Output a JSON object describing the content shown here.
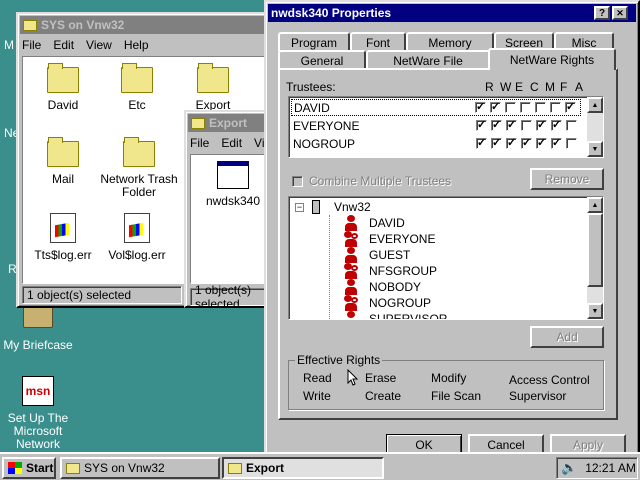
{
  "desktop": {
    "briefcase_label": "My Briefcase",
    "msn_line1": "Set Up The",
    "msn_line2": "Microsoft",
    "msn_line3": "Network",
    "msn_logo": "msn",
    "partial_labels": [
      "M",
      "Ne",
      "R"
    ]
  },
  "sys_window": {
    "title": "SYS on Vnw32",
    "menu": [
      "File",
      "Edit",
      "View",
      "Help"
    ],
    "items": [
      {
        "label": "David",
        "icon": "folder-icon"
      },
      {
        "label": "Etc",
        "icon": "folder-icon"
      },
      {
        "label": "Export",
        "icon": "folder-icon"
      },
      {
        "label": "Mail",
        "icon": "folder-icon"
      },
      {
        "label": "Network Trash Folder",
        "icon": "folder-icon"
      },
      {
        "label": "Tts$log.err",
        "icon": "file-icon"
      },
      {
        "label": "Vol$log.err",
        "icon": "file-icon"
      }
    ],
    "status": "1 object(s) selected"
  },
  "export_window": {
    "title": "Export",
    "menu": [
      "File",
      "Edit",
      "Vie"
    ],
    "item_label": "nwdsk340",
    "status": "1 object(s) selected"
  },
  "props": {
    "title": "nwdsk340 Properties",
    "help_btn": "?",
    "close_btn": "✕",
    "tabs_row1": [
      "Program",
      "Font",
      "Memory",
      "Screen",
      "Misc"
    ],
    "tabs_row2": [
      "General",
      "NetWare File",
      "NetWare Rights"
    ],
    "trustees_label": "Trustees:",
    "rights_headers": [
      "R",
      "W",
      "E",
      "C",
      "M",
      "F",
      "A"
    ],
    "trustees": [
      {
        "name": "DAVID",
        "rights": [
          true,
          true,
          false,
          false,
          false,
          false,
          true
        ]
      },
      {
        "name": "EVERYONE",
        "rights": [
          true,
          true,
          true,
          false,
          true,
          true,
          false
        ]
      },
      {
        "name": "NOGROUP",
        "rights": [
          true,
          true,
          true,
          true,
          true,
          true,
          false
        ]
      }
    ],
    "combine_label": "Combine Multiple Trustees",
    "remove_btn": "Remove",
    "tree_root": "Vnw32",
    "tree_items": [
      {
        "name": "DAVID",
        "kind": "user"
      },
      {
        "name": "EVERYONE",
        "kind": "group"
      },
      {
        "name": "GUEST",
        "kind": "user"
      },
      {
        "name": "NFSGROUP",
        "kind": "group"
      },
      {
        "name": "NOBODY",
        "kind": "user"
      },
      {
        "name": "NOGROUP",
        "kind": "group"
      },
      {
        "name": "SUPERVISOR",
        "kind": "user"
      }
    ],
    "add_btn": "Add",
    "effective_rights": {
      "label": "Effective Rights",
      "col1": [
        "Read",
        "Write"
      ],
      "col2": [
        "Erase",
        "Create"
      ],
      "col3": [
        "Modify",
        "File Scan"
      ],
      "col4": [
        "Access Control",
        "Supervisor"
      ]
    },
    "ok_btn": "OK",
    "cancel_btn": "Cancel",
    "apply_btn": "Apply"
  },
  "taskbar": {
    "start": "Start",
    "tasks": [
      {
        "label": "SYS on Vnw32",
        "pressed": false
      },
      {
        "label": "Export",
        "pressed": true
      }
    ],
    "clock": "12:21 AM"
  }
}
